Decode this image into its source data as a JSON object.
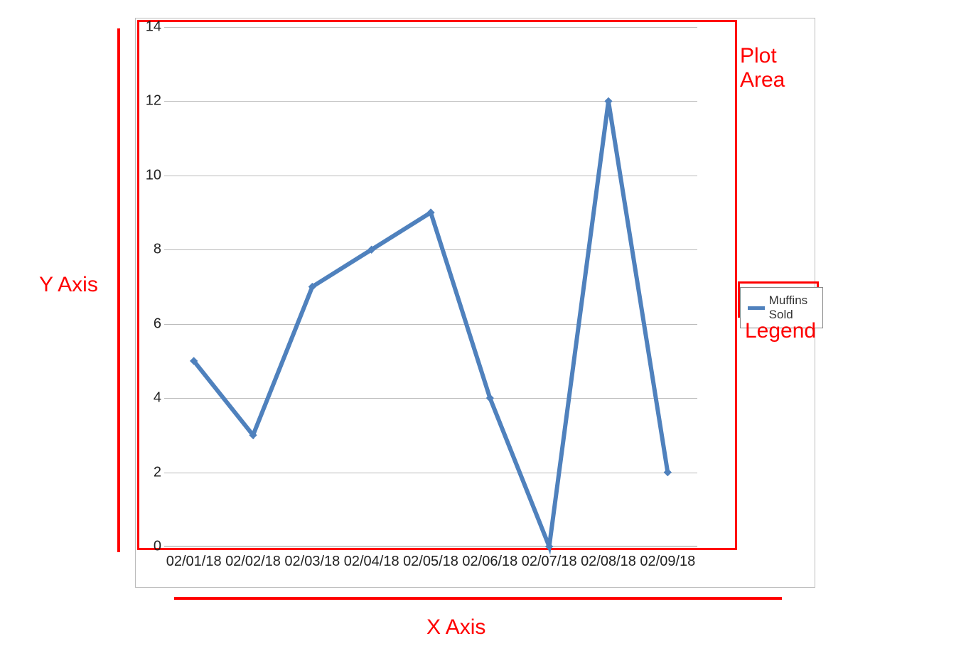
{
  "annotations": {
    "y_axis_label": "Y Axis",
    "x_axis_label": "X Axis",
    "plot_area_label": "Plot Area",
    "legend_label": "Legend"
  },
  "legend": {
    "series_name": "Muffins Sold"
  },
  "y_ticks": [
    "0",
    "2",
    "4",
    "6",
    "8",
    "10",
    "12",
    "14"
  ],
  "x_ticks": [
    "02/01/18",
    "02/02/18",
    "02/03/18",
    "02/04/18",
    "02/05/18",
    "02/06/18",
    "02/07/18",
    "02/08/18",
    "02/09/18"
  ],
  "colors": {
    "series": "#4f81bd",
    "annotation": "#ff0000"
  },
  "chart_data": {
    "type": "line",
    "title": "",
    "xlabel": "",
    "ylabel": "",
    "ylim": [
      0,
      14
    ],
    "categories": [
      "02/01/18",
      "02/02/18",
      "02/03/18",
      "02/04/18",
      "02/05/18",
      "02/06/18",
      "02/07/18",
      "02/08/18",
      "02/09/18"
    ],
    "series": [
      {
        "name": "Muffins Sold",
        "values": [
          5,
          3,
          7,
          8,
          9,
          4,
          0,
          12,
          2
        ]
      }
    ],
    "grid": true,
    "legend_position": "right"
  }
}
